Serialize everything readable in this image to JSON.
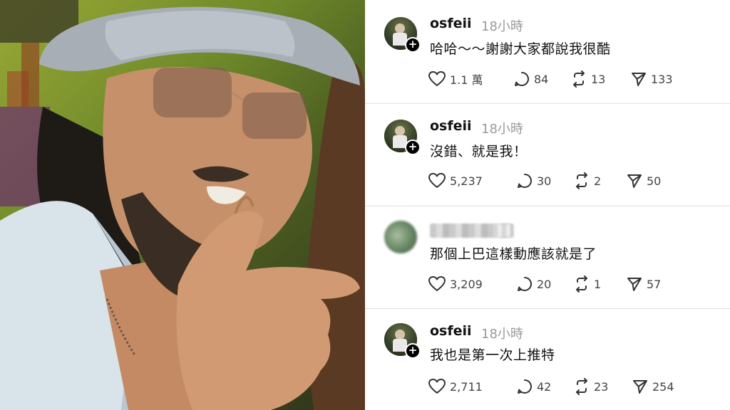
{
  "posts": [
    {
      "username": "osfeii",
      "time": "18小時",
      "text": "哈哈～～謝謝大家都說我很酷",
      "likes": "1.1 萬",
      "replies": "84",
      "reposts": "13",
      "shares": "133",
      "blurred": false
    },
    {
      "username": "osfeii",
      "time": "18小時",
      "text": "沒錯、就是我！",
      "likes": "5,237",
      "replies": "30",
      "reposts": "2",
      "shares": "50",
      "blurred": false
    },
    {
      "username": "",
      "time": "",
      "text": "那個上巴這樣動應該就是了",
      "likes": "3,209",
      "replies": "20",
      "reposts": "1",
      "shares": "57",
      "blurred": true
    },
    {
      "username": "osfeii",
      "time": "18小時",
      "text": "我也是第一次上推特",
      "likes": "2,711",
      "replies": "42",
      "reposts": "23",
      "shares": "254",
      "blurred": false
    }
  ],
  "icons": {
    "like": "heart-icon",
    "reply": "comment-icon",
    "repost": "repost-icon",
    "share": "send-icon",
    "follow": "plus-icon"
  },
  "colors": {
    "text": "#111111",
    "muted": "#9a9a9a",
    "divider": "#e2e2e2"
  }
}
